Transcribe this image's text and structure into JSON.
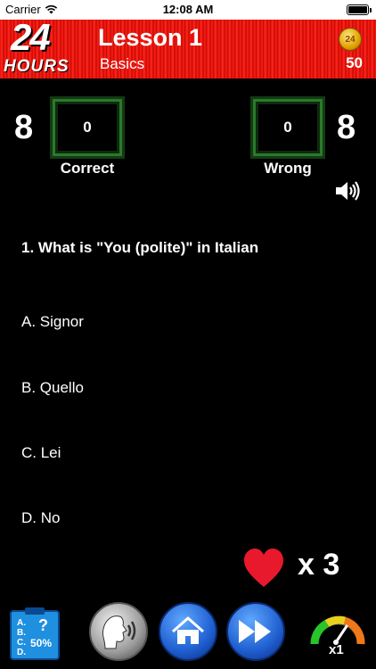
{
  "status_bar": {
    "carrier": "Carrier",
    "time": "12:08 AM"
  },
  "header": {
    "logo_number": "24",
    "logo_text": "HOURS",
    "title": "Lesson 1",
    "subtitle": "Basics",
    "coin_text": "24",
    "coins": "50"
  },
  "scores": {
    "left_total": "8",
    "right_total": "8",
    "correct_value": "0",
    "wrong_value": "0",
    "correct_label": "Correct",
    "wrong_label": "Wrong"
  },
  "question": {
    "text": "1. What is \"You (polite)\" in Italian",
    "answers": [
      {
        "label": "A. Signor"
      },
      {
        "label": "B. Quello"
      },
      {
        "label": "C. Lei"
      },
      {
        "label": "D. No"
      }
    ]
  },
  "lives": {
    "count": "x 3"
  },
  "toolbar": {
    "hint_letters": [
      "A.",
      "B.",
      "C.",
      "D."
    ],
    "hint_percent": "50%",
    "speed": "x1"
  },
  "colors": {
    "header_red": "#e01010",
    "score_border": "#2a7a2a",
    "heart": "#e8192c",
    "button_blue": "#1f5fd0"
  }
}
